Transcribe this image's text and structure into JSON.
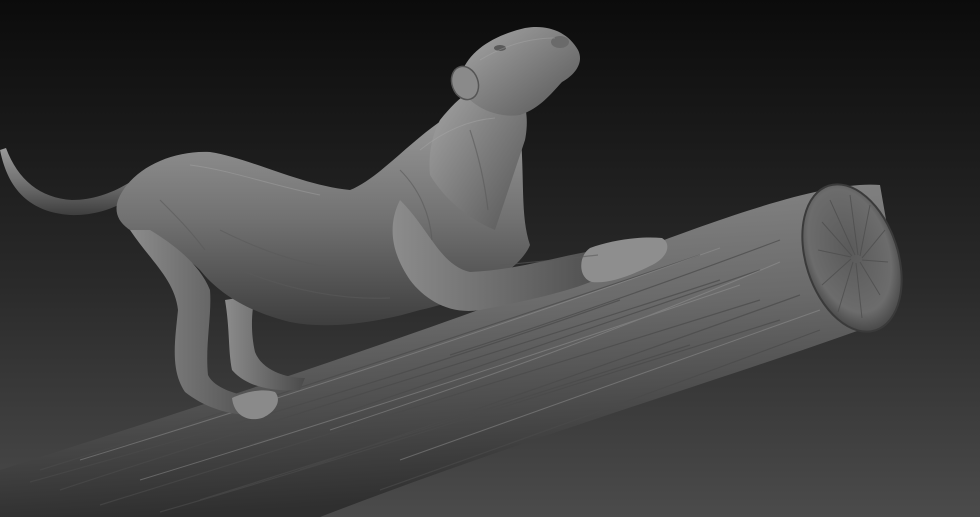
{
  "scene": {
    "subject": "panther-sculpt",
    "prop": "log",
    "colors": {
      "background_top": "#0c0c0c",
      "background_bottom": "#4a4a4a",
      "clay": "#7a7a7a"
    }
  }
}
